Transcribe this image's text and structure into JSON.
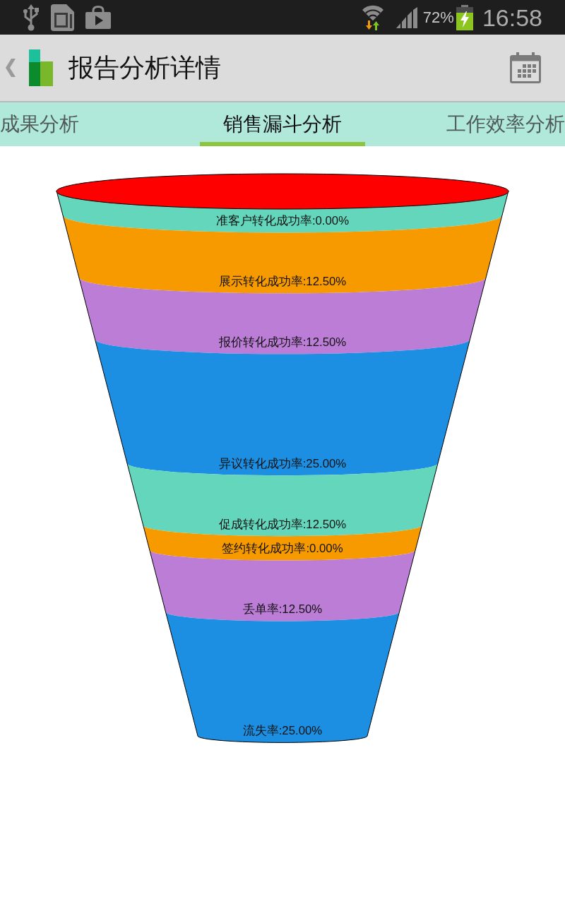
{
  "status_bar": {
    "battery_percent": "72%",
    "time": "16:58"
  },
  "app_bar": {
    "title": "报告分析详情"
  },
  "tabs": [
    {
      "label": "成果分析",
      "selected": false
    },
    {
      "label": "销售漏斗分析",
      "selected": true
    },
    {
      "label": "工作效率分析",
      "selected": false
    }
  ],
  "funnel": {
    "stages": [
      {
        "label": "准客户转化成功率:0.00%",
        "color": "#64d6bb"
      },
      {
        "label": "展示转化成功率:12.50%",
        "color": "#f79a00"
      },
      {
        "label": "报价转化成功率:12.50%",
        "color": "#bb7dd6"
      },
      {
        "label": "异议转化成功率:25.00%",
        "color": "#1c8fe2"
      },
      {
        "label": "促成转化成功率:12.50%",
        "color": "#64d6bb"
      },
      {
        "label": "签约转化成功率:0.00%",
        "color": "#f79a00"
      },
      {
        "label": "丢单率:12.50%",
        "color": "#bb7dd6"
      },
      {
        "label": "流失率:25.00%",
        "color": "#1c8fe2"
      }
    ]
  }
}
